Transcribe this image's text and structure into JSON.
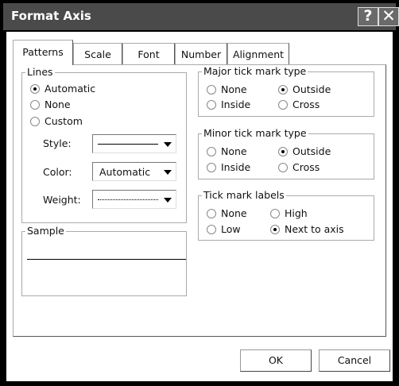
{
  "window": {
    "title": "Format Axis",
    "help_symbol": "?",
    "close_symbol": "✕"
  },
  "tabs": [
    {
      "label": "Patterns",
      "selected": true
    },
    {
      "label": "Scale",
      "selected": false
    },
    {
      "label": "Font",
      "selected": false
    },
    {
      "label": "Number",
      "selected": false
    },
    {
      "label": "Alignment",
      "selected": false
    }
  ],
  "lines": {
    "label": "Lines",
    "options": {
      "automatic": "Automatic",
      "none": "None",
      "custom": "Custom"
    },
    "selected": "Automatic",
    "style_label": "Style:",
    "color_label": "Color:",
    "color_value": "Automatic",
    "weight_label": "Weight:"
  },
  "sample": {
    "label": "Sample"
  },
  "major_tick": {
    "label": "Major tick mark type",
    "options": {
      "none": "None",
      "outside": "Outside",
      "inside": "Inside",
      "cross": "Cross"
    },
    "selected": "Outside"
  },
  "minor_tick": {
    "label": "Minor tick mark type",
    "options": {
      "none": "None",
      "outside": "Outside",
      "inside": "Inside",
      "cross": "Cross"
    },
    "selected": "Outside"
  },
  "tick_labels": {
    "label": "Tick mark labels",
    "options": {
      "none": "None",
      "high": "High",
      "low": "Low",
      "next_to_axis": "Next to axis"
    },
    "selected": "Next to axis"
  },
  "buttons": {
    "ok": "OK",
    "cancel": "Cancel"
  }
}
